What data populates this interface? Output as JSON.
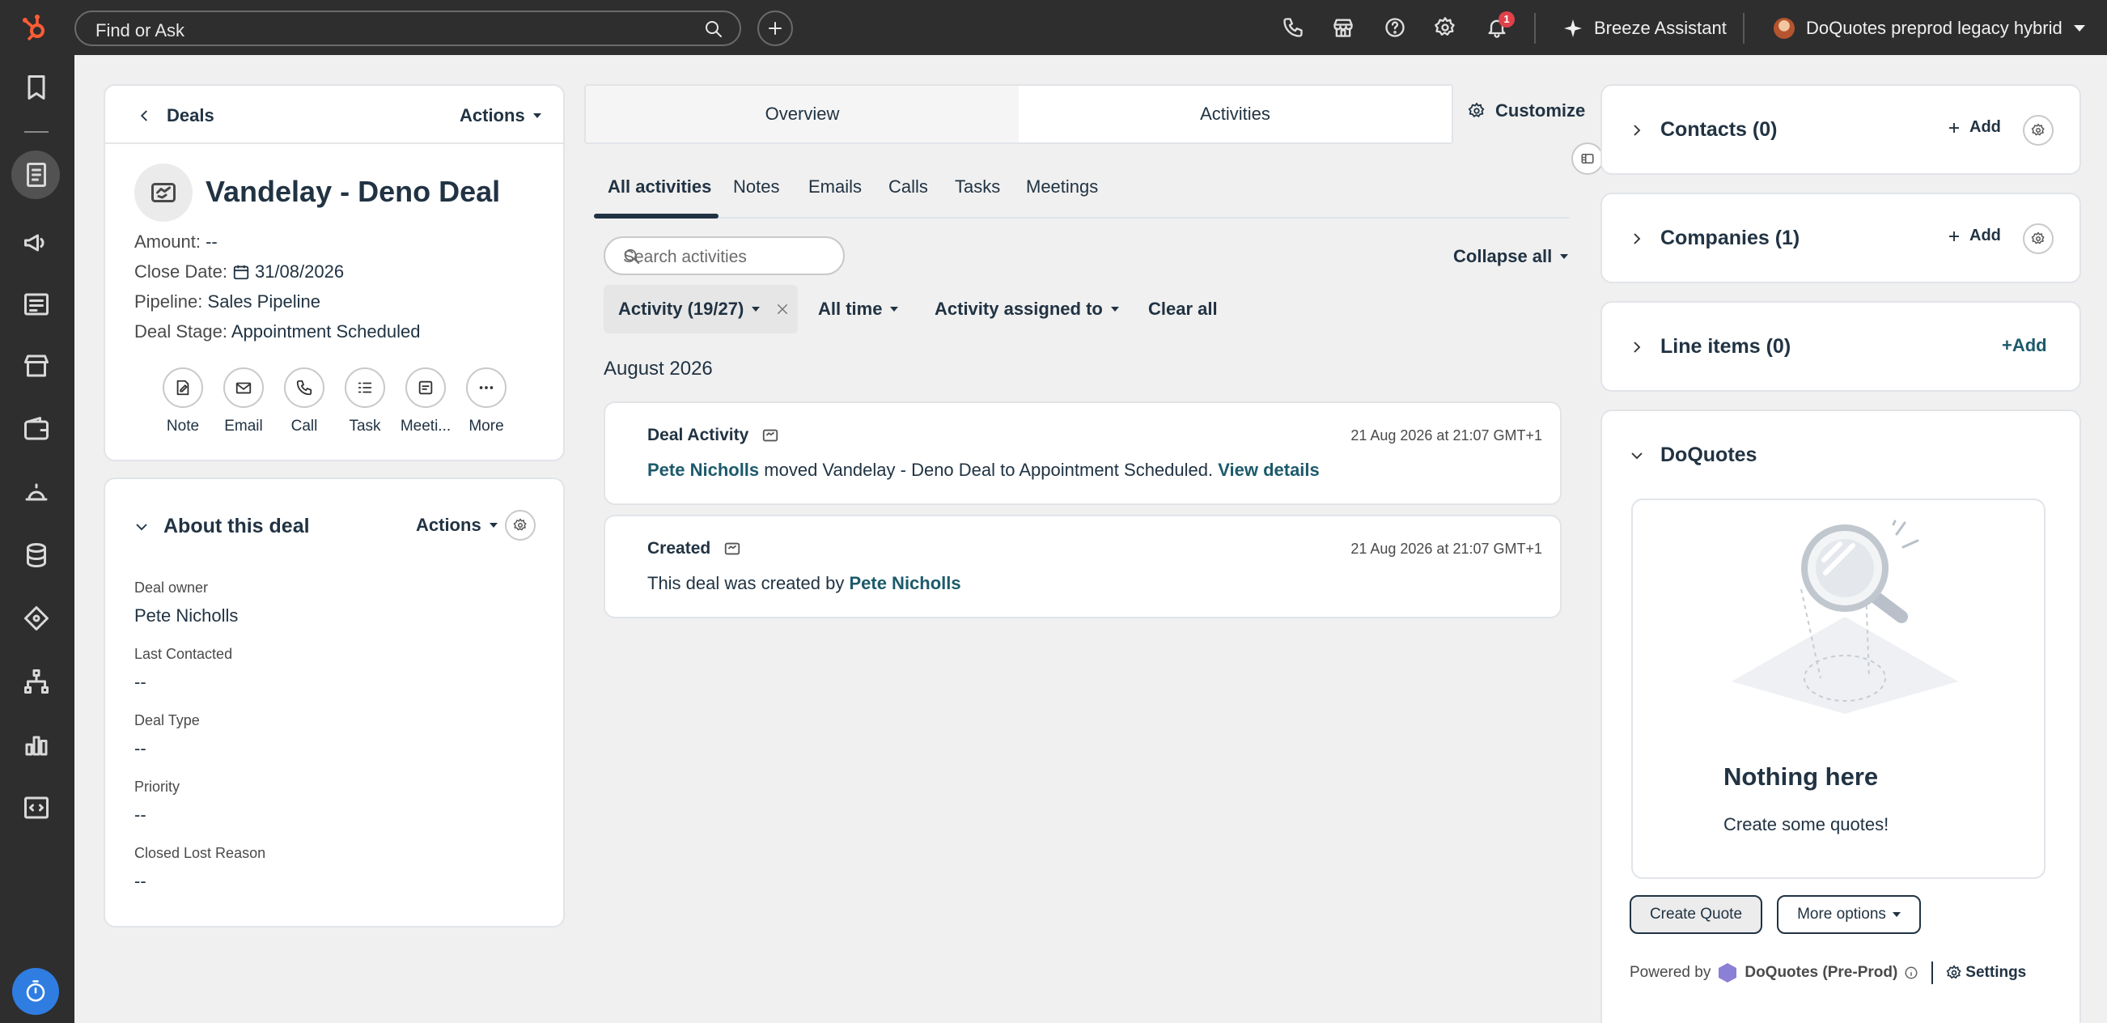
{
  "topbar": {
    "search_placeholder": "Find or Ask",
    "notification_count": "1",
    "assistant_label": "Breeze Assistant",
    "account_name": "DoQuotes preprod legacy hybrid"
  },
  "record": {
    "back_label": "Deals",
    "actions_label": "Actions",
    "deal_name": "Vandelay - Deno Deal",
    "props": [
      {
        "label": "Amount:",
        "value": "--"
      },
      {
        "label": "Close Date:",
        "value": "31/08/2026"
      },
      {
        "label": "Pipeline:",
        "value": "Sales Pipeline"
      },
      {
        "label": "Deal Stage:",
        "value": "Appointment Scheduled"
      }
    ],
    "quick_actions": [
      "Note",
      "Email",
      "Call",
      "Task",
      "Meeti...",
      "More"
    ]
  },
  "about": {
    "title": "About this deal",
    "actions_label": "Actions",
    "fields": [
      {
        "label": "Deal owner",
        "value": "Pete Nicholls"
      },
      {
        "label": "Last Contacted",
        "value": "--"
      },
      {
        "label": "Deal Type",
        "value": "--"
      },
      {
        "label": "Priority",
        "value": "--"
      },
      {
        "label": "Closed Lost Reason",
        "value": "--"
      }
    ]
  },
  "main_tabs": [
    "Overview",
    "Activities"
  ],
  "customize_label": "Customize",
  "activity_tabs": [
    "All activities",
    "Notes",
    "Emails",
    "Calls",
    "Tasks",
    "Meetings"
  ],
  "activity_search_placeholder": "Search activities",
  "collapse_all_label": "Collapse all",
  "filters": {
    "activity_chip": "Activity (19/27)",
    "time": "All time",
    "assigned": "Activity assigned to",
    "clear": "Clear all"
  },
  "month_heading": "August 2026",
  "activities": [
    {
      "type": "Deal Activity",
      "timestamp": "21 Aug 2026 at 21:07 GMT+1",
      "actor": "Pete Nicholls",
      "text": " moved Vandelay - Deno Deal to Appointment Scheduled. ",
      "link": "View details"
    },
    {
      "type": "Created",
      "timestamp": "21 Aug 2026 at 21:07 GMT+1",
      "text": "This deal was created by ",
      "actor": "Pete Nicholls"
    }
  ],
  "sidebar": {
    "contacts_title": "Contacts (0)",
    "companies_title": "Companies (1)",
    "line_items_title": "Line items (0)",
    "add_label": "Add",
    "line_items_add": "+Add",
    "doquotes": {
      "title": "DoQuotes",
      "empty_title": "Nothing here",
      "empty_sub": "Create some quotes!",
      "create_btn": "Create Quote",
      "more_btn": "More options",
      "powered_by": "Powered by",
      "brand": "DoQuotes (Pre-Prod)",
      "settings": "Settings"
    }
  },
  "colors": {
    "accent_link": "#1c5a6b",
    "topbar_bg": "#2e2e2e",
    "hubspot_orange": "#ff5c35",
    "timer_blue": "#2f7de1"
  }
}
